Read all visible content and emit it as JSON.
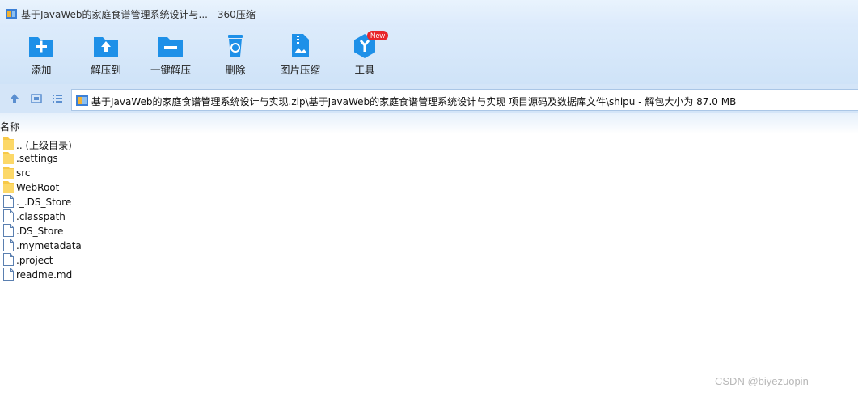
{
  "window": {
    "title": "基于JavaWeb的家庭食谱管理系统设计与... - 360压缩"
  },
  "toolbar": {
    "items": [
      {
        "label": "添加",
        "icon": "add-icon"
      },
      {
        "label": "解压到",
        "icon": "extract-to-icon"
      },
      {
        "label": "一键解压",
        "icon": "one-click-extract-icon"
      },
      {
        "label": "删除",
        "icon": "delete-icon"
      },
      {
        "label": "图片压缩",
        "icon": "image-compress-icon"
      },
      {
        "label": "工具",
        "icon": "tools-icon",
        "badge": "New"
      }
    ]
  },
  "navbar": {
    "path": "基于JavaWeb的家庭食谱管理系统设计与实现.zip\\基于JavaWeb的家庭食谱管理系统设计与实现 项目源码及数据库文件\\shipu - 解包大小为 87.0 MB"
  },
  "list": {
    "column_name": "名称",
    "files": [
      {
        "name": ".. (上级目录)",
        "type": "folder"
      },
      {
        "name": ".settings",
        "type": "folder"
      },
      {
        "name": "src",
        "type": "folder"
      },
      {
        "name": "WebRoot",
        "type": "folder"
      },
      {
        "name": "._.DS_Store",
        "type": "file"
      },
      {
        "name": ".classpath",
        "type": "file"
      },
      {
        "name": ".DS_Store",
        "type": "file"
      },
      {
        "name": ".mymetadata",
        "type": "file"
      },
      {
        "name": ".project",
        "type": "file"
      },
      {
        "name": "readme.md",
        "type": "file"
      }
    ]
  },
  "watermark": "CSDN @biyezuopin",
  "colors": {
    "accent": "#1e90e8",
    "folder": "#f7c948",
    "badge": "#e8262b"
  }
}
